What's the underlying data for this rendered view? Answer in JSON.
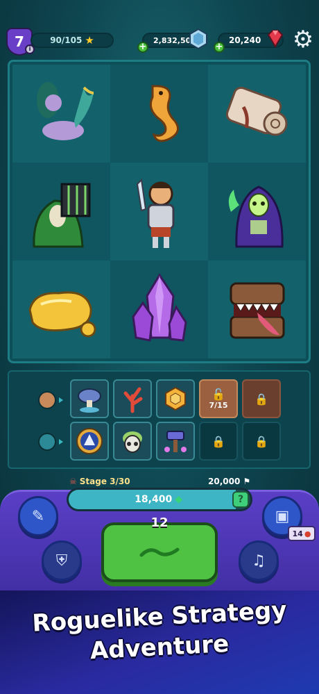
{
  "header": {
    "level": "7",
    "xp_text": "90/105",
    "gems_text": "2,832,500",
    "rubies_text": "20,240"
  },
  "board": {
    "tiles": [
      "mermaid",
      "seahorse",
      "scroll",
      "caged-hooded-prisoner",
      "hero-warrior",
      "skeleton-mage",
      "gold-nugget",
      "purple-crystal",
      "mimic-chest"
    ]
  },
  "inventory": {
    "row1": [
      {
        "item": "mushroom-artifact"
      },
      {
        "item": "coral-artifact"
      },
      {
        "item": "honeycomb-artifact"
      },
      {
        "item": "unlock-slot",
        "text": "7/15"
      },
      {
        "item": "locked-slot"
      }
    ],
    "row2": [
      {
        "item": "shield-emblem"
      },
      {
        "item": "skull-relic"
      },
      {
        "item": "hammer-relic"
      },
      {
        "item": "locked-slot"
      },
      {
        "item": "locked-slot"
      }
    ]
  },
  "stage": {
    "label": "Stage 3/30",
    "goal": "20,000",
    "score": "18,400",
    "progress": 0.92
  },
  "controls": {
    "turns_left": "12",
    "cost_value": "14"
  },
  "banner": {
    "line1": "Roguelike Strategy",
    "line2": "Adventure"
  },
  "colors": {
    "background": "#0e4650",
    "play_button": "#4fc244",
    "panel": "#5a3fc6",
    "accent_gem": "#d8402f"
  }
}
